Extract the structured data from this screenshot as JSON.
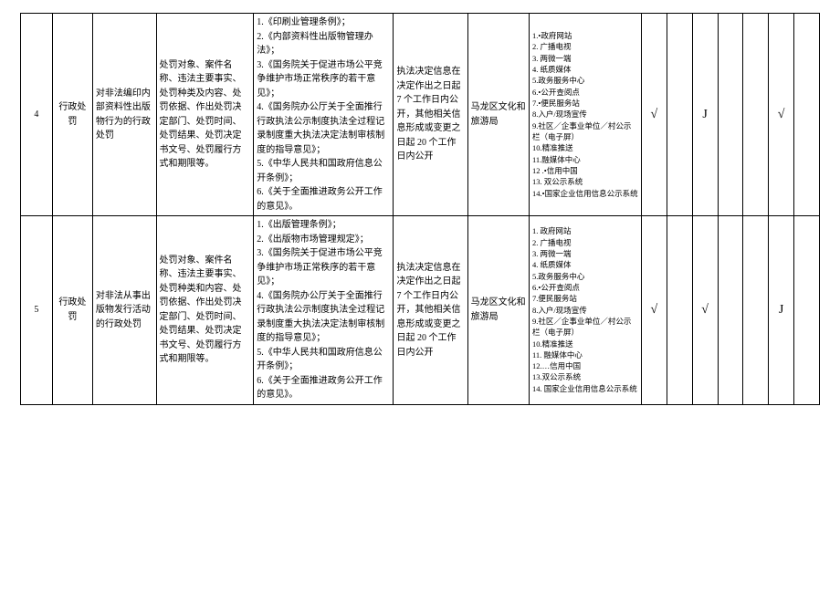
{
  "rows": [
    {
      "no": "4",
      "type": "行政处罚",
      "name": "对非法编印内部资料性出版物行为的行政处罚",
      "content": "处罚对象、案件名称、违法主要事实、处罚种类及内容、处罚依据、作出处罚决定部门、处罚时间、处罚结果、处罚决定书文号、处罚履行方式和期限等。",
      "basis": "1.《印刷业管理条例》；\n2.《内部资料性出版物管理办法》；\n3.《国务院关于促进市场公平竞争维护市场正常秩序的若干意见》；\n4.《国务院办公厅关于全面推行行政执法公示制度执法全过程记录制度重大执法决定法制审核制度的指导意见》；\n5.《中华人民共和国政府信息公开条例》；\n6.《关于全面推进政务公开工作的意见》。",
      "time": "执法决定信息在决定作出之日起 7 个工作日内公开，其他相关信息形成或变更之日起 20 个工作日内公开",
      "dept": "马龙区文化和旅游局",
      "channels": [
        "1.•政府网站",
        "2. 广播电视",
        "3. 两微一端",
        "4. 纸质媒体",
        "5.政务服务中心",
        "6.•公开查阅点",
        "7.•便民服务站",
        "8.入户/现场宣传",
        "9.社区／企事业单位／村公示栏（电子屏）",
        "10.精准推送",
        "11.融媒体中心",
        "12 .•信用中国",
        "13. 双公示系统",
        "14.•国家企业信用信息公示系统"
      ],
      "m1": "√",
      "m2": "",
      "m3": "J",
      "m4": "",
      "m5": "",
      "m6": "√",
      "m7": ""
    },
    {
      "no": "5",
      "type": "行政处罚",
      "name": "对非法从事出版物发行活动的行政处罚",
      "content": "处罚对象、案件名称、违法主要事实、处罚种类和内容、处罚依据、作出处罚决定部门、处罚时间、处罚结果、处罚决定书文号、处罚履行方式和期限等。",
      "basis": "1.《出版管理条例》；\n2.《出版物市场管理规定》；\n3.《国务院关于促进市场公平竞争维护市场正常秩序的若干意见》；\n4.《国务院办公厅关于全面推行行政执法公示制度执法全过程记录制度重大执法决定法制审核制度的指导意见》；\n5.《中华人民共和国政府信息公开条例》；\n6.《关于全面推进政务公开工作的意见》。",
      "time": "执法决定信息在决定作出之日起 7 个工作日内公开，其他相关信息形成或变更之日起 20 个工作日内公开",
      "dept": "马龙区文化和旅游局",
      "channels": [
        "1. 政府网站",
        "2. 广播电视",
        "3. 两微一端",
        "4. 纸质媒体",
        "5.政务服务中心",
        "6.•公开查阅点",
        "7.便民服务站",
        "8.入户/现场宣传",
        "9.社区／企事业单位／村公示栏（电子屏）",
        "10.精准推送",
        "11. 融媒体中心",
        "12.…信用中国",
        "13.双公示系统",
        "14. 国家企业信用信息公示系统"
      ],
      "m1": "√",
      "m2": "",
      "m3": "√",
      "m4": "",
      "m5": "",
      "m6": "J",
      "m7": ""
    }
  ]
}
